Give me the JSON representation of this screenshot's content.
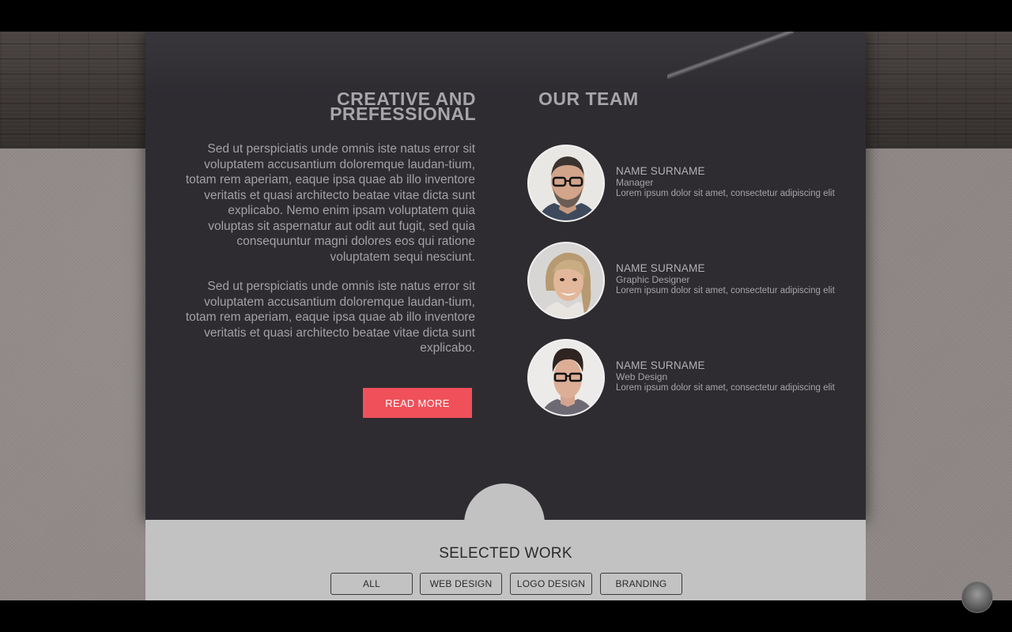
{
  "about": {
    "title_line1": "CREATIVE AND",
    "title_line2": "PREFESSIONAL",
    "paragraph1": "Sed ut perspiciatis unde omnis iste natus error sit voluptatem accusantium doloremque laudan-tium, totam rem aperiam, eaque ipsa quae ab illo inventore veritatis et quasi architecto beatae vitae dicta sunt explicabo. Nemo enim ipsam voluptatem quia voluptas sit aspernatur aut odit aut fugit, sed quia consequuntur magni dolores eos qui ratione voluptatem sequi nesciunt.",
    "paragraph2": "Sed ut perspiciatis unde omnis iste natus error sit voluptatem accusantium doloremque laudan-tium, totam rem aperiam, eaque ipsa quae ab illo inventore veritatis et quasi architecto beatae vitae dicta sunt explicabo.",
    "read_more_label": "READ MORE"
  },
  "team": {
    "title": "OUR TEAM",
    "members": [
      {
        "name": "NAME SURNAME",
        "role": "Manager",
        "desc": "Lorem ipsum dolor sit amet, consectetur adipiscing elit"
      },
      {
        "name": "NAME SURNAME",
        "role": "Graphic Designer",
        "desc": "Lorem ipsum dolor sit amet, consectetur adipiscing elit"
      },
      {
        "name": "NAME SURNAME",
        "role": "Web Design",
        "desc": "Lorem ipsum dolor sit amet, consectetur adipiscing elit"
      }
    ]
  },
  "work": {
    "title": "SELECTED WORK",
    "filters": [
      "ALL",
      "WEB DESIGN",
      "LOGO DESIGN",
      "BRANDING"
    ]
  },
  "colors": {
    "panel": "#2e2c31",
    "accent": "#f05059",
    "work_bg": "#c3c2c2"
  }
}
